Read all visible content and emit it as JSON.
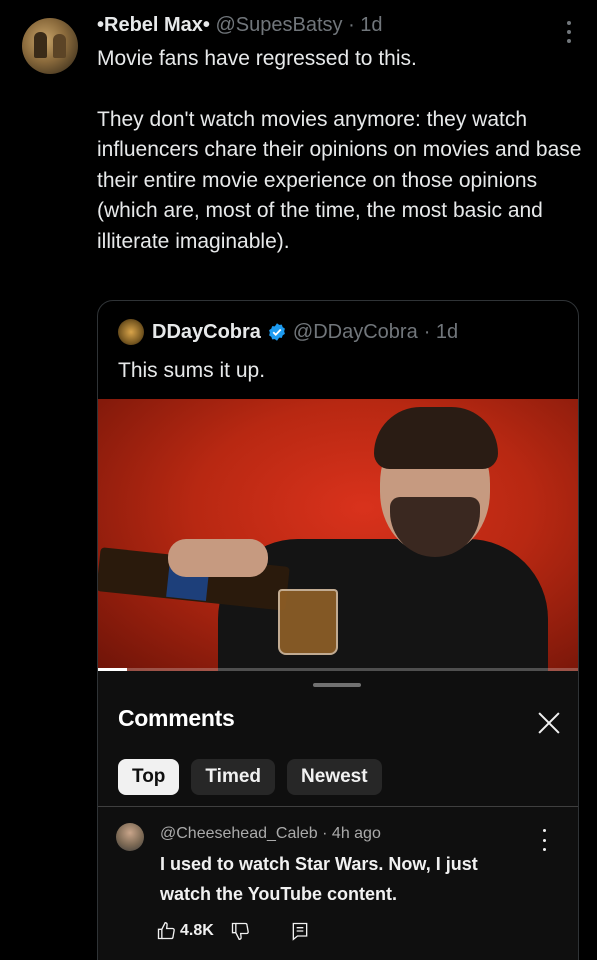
{
  "post": {
    "author_name": "•Rebel Max•",
    "handle": "@SupesBatsy",
    "time": "· 1d",
    "paragraph_1": "Movie fans have regressed to this.",
    "paragraph_2": "They don't watch movies anymore: they watch influencers chare their opinions on movies and base their entire movie experience on those opinions (which are, most of the time, the most basic and illiterate imaginable)."
  },
  "quote": {
    "author_name": "DDayCobra",
    "handle": "@DDayCobra",
    "time": "· 1d",
    "text": "This sums it up.",
    "verified_color": "#1d9bf0"
  },
  "video": {
    "progress": 0.06
  },
  "comments_panel": {
    "title": "Comments",
    "chips": [
      "Top",
      "Timed",
      "Newest"
    ],
    "active_chip": "Top",
    "comment": {
      "author": "@Cheesehead_Caleb",
      "time": "· 4h ago",
      "text": "I used to watch Star Wars. Now, I just watch the YouTube content.",
      "likes": "4.8K"
    }
  },
  "colors": {
    "background": "#000000",
    "text_primary": "#e7e9ea",
    "text_secondary": "#71767b",
    "panel": "#0f0f0f",
    "chip_bg": "#272727",
    "chip_active_bg": "#f1f1f1"
  }
}
